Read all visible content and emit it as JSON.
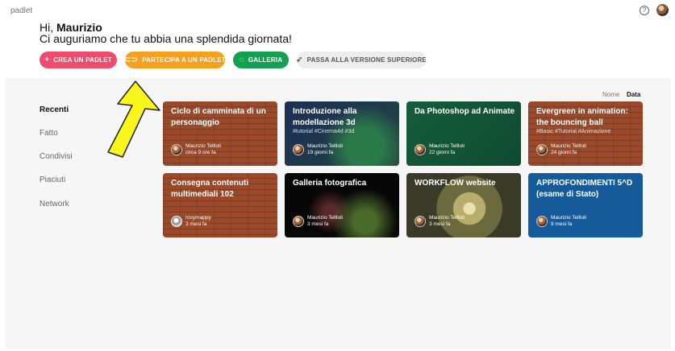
{
  "app": {
    "brand": "padlet",
    "help_icon": "question-circle-icon",
    "avatar_icon": "user-avatar"
  },
  "greeting": {
    "hi": "Hi, ",
    "name": "Maurizio",
    "message": "Ci auguriamo che tu abbia una splendida giornata!"
  },
  "actions": [
    {
      "label": "CREA UN PADLET",
      "icon": "+",
      "color": "#ef4b6c"
    },
    {
      "label": "PARTECIPA A UN PADLET",
      "icon": "⊂⊃",
      "color": "#f6a020"
    },
    {
      "label": "GALLERIA",
      "icon": "◌",
      "color": "#14a052"
    },
    {
      "label": "PASSA ALLA VERSIONE SUPERIORE",
      "icon": "🚀",
      "color": "#ededed"
    }
  ],
  "sort": {
    "nome": "Nome",
    "data": "Data"
  },
  "sidebar": [
    {
      "label": "Recenti"
    },
    {
      "label": "Fatto"
    },
    {
      "label": "Condivisi"
    },
    {
      "label": "Piaciuti"
    },
    {
      "label": "Network"
    }
  ],
  "cards": [
    {
      "title": "Ciclo di camminata di un personaggio",
      "tags": "",
      "author": "Maurizio Tellloli",
      "time": "circa 9 ore fa",
      "bg": "brick"
    },
    {
      "title": "Introduzione alla modellazione 3d",
      "tags": "#tutorial #Cinema4d #3d",
      "author": "Maurizio Tellloli",
      "time": "19 giorni fa",
      "bg": "navy"
    },
    {
      "title": "Da Photoshop ad Animate",
      "tags": "",
      "author": "Maurizio Tellloli",
      "time": "22 giorni fa",
      "bg": "green"
    },
    {
      "title": "Evergreen in animation: the bouncing ball",
      "tags": "#Basic #Tutorial #Animazione",
      "author": "Maurizio Tellloli",
      "time": "24 giorni fa",
      "bg": "brick"
    },
    {
      "title": "Consegna contenuti multimediali 102",
      "tags": "",
      "author": "rosymappy",
      "time": "3 mesi fa",
      "bg": "brick"
    },
    {
      "title": "Galleria fotografica",
      "tags": "",
      "author": "Maurizio Tellloli",
      "time": "3 mesi fa",
      "bg": "black"
    },
    {
      "title": "WORKFLOW website",
      "tags": "",
      "author": "Maurizio Tellloli",
      "time": "3 mesi fa",
      "bg": "tunnel"
    },
    {
      "title": "APPROFONDIMENTI 5^D (esame di Stato)",
      "tags": "",
      "author": "Maurizio Tellloli",
      "time": "9 mesi fa",
      "bg": "blue"
    }
  ]
}
